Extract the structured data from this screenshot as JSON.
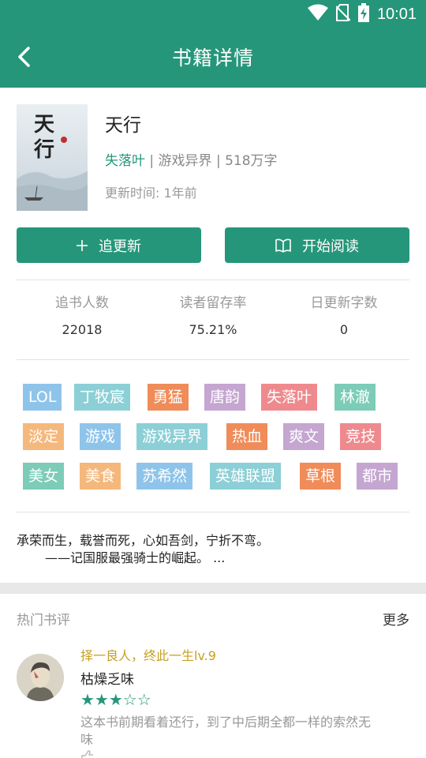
{
  "status_bar": {
    "time": "10:01",
    "icons": [
      "wifi-icon",
      "no-sim-icon",
      "battery-charging-icon"
    ]
  },
  "header": {
    "title": "书籍详情",
    "back_icon": "back-arrow-icon"
  },
  "book": {
    "title": "天行",
    "author": "失落叶",
    "category": "游戏异界",
    "words": "518万字",
    "separator": "|",
    "update_time": "更新时间: 1年前",
    "cover_text": "天行"
  },
  "actions": {
    "follow": {
      "label": "追更新",
      "icon": "plus-icon"
    },
    "read": {
      "label": "开始阅读",
      "icon": "open-book-icon"
    }
  },
  "stats": [
    {
      "label": "追书人数",
      "value": "22018"
    },
    {
      "label": "读者留存率",
      "value": "75.21%"
    },
    {
      "label": "日更新字数",
      "value": "0"
    }
  ],
  "tags": [
    {
      "text": "LOL",
      "color": "#8fc4ea"
    },
    {
      "text": "丁牧宸",
      "color": "#8ccfd6"
    },
    {
      "text": "勇猛",
      "color": "#f08c5a"
    },
    {
      "text": "唐韵",
      "color": "#c4a6d0"
    },
    {
      "text": "失落叶",
      "color": "#ee8a8e"
    },
    {
      "text": "林澈",
      "color": "#7cccb8"
    },
    {
      "text": "淡定",
      "color": "#f5b87c"
    },
    {
      "text": "游戏",
      "color": "#8fc4ea"
    },
    {
      "text": "游戏异界",
      "color": "#8ccfd6"
    },
    {
      "text": "热血",
      "color": "#f08c5a"
    },
    {
      "text": "爽文",
      "color": "#c4a6d0"
    },
    {
      "text": "竞技",
      "color": "#ee8a8e"
    },
    {
      "text": "美女",
      "color": "#7cccb8"
    },
    {
      "text": "美食",
      "color": "#f5b87c"
    },
    {
      "text": "苏希然",
      "color": "#8fc4ea"
    },
    {
      "text": "英雄联盟",
      "color": "#8ccfd6"
    },
    {
      "text": "草根",
      "color": "#f08c5a"
    },
    {
      "text": "都市",
      "color": "#c4a6d0"
    }
  ],
  "intro": {
    "line1": "承荣而生，载誉而死，心如吾剑，宁折不弯。",
    "line2": "——记国服最强骑士的崛起。 ..."
  },
  "reviews_section": {
    "heading": "热门书评",
    "more": "更多"
  },
  "review": {
    "user": "择一良人，终此一生lv.9",
    "title": "枯燥乏味",
    "stars": "★★★☆☆",
    "rating": 3,
    "body": "这本书前期看着还行，到了中后期全都一样的索然无味"
  },
  "colors": {
    "primary": "#26967a",
    "user_gold": "#c8a020"
  }
}
